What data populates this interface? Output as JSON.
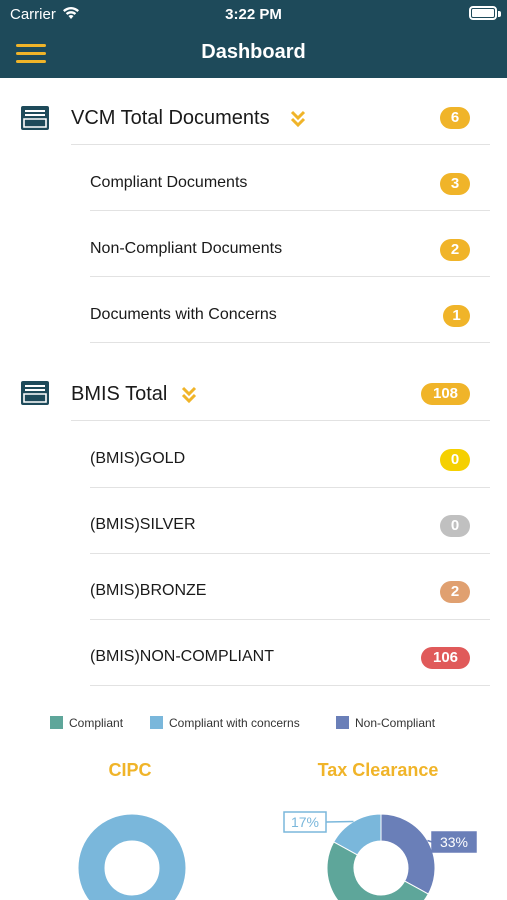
{
  "status_bar": {
    "carrier": "Carrier",
    "time": "3:22 PM"
  },
  "nav": {
    "title": "Dashboard",
    "menu_icon": "hamburger-icon"
  },
  "colors": {
    "header_bg": "#1e4a5a",
    "accent": "#f0b429",
    "badge_orange": "#f0b429",
    "badge_gold": "#f5d000",
    "badge_silver": "#c0c0c0",
    "badge_bronze": "#e0a070",
    "badge_red": "#e05a5a",
    "compliant": "#5ea69a",
    "compliant_with_concerns": "#7ab7db",
    "non_compliant": "#6a7fb8"
  },
  "vcm": {
    "title": "VCM Total Documents",
    "total": "6",
    "icon": "document-tray-icon",
    "items": [
      {
        "label": "Compliant Documents",
        "count": "3"
      },
      {
        "label": "Non-Compliant Documents",
        "count": "2"
      },
      {
        "label": "Documents with Concerns",
        "count": "1"
      }
    ]
  },
  "bmis": {
    "title": "BMIS Total",
    "total": "108",
    "icon": "document-tray-icon",
    "items": [
      {
        "label": "(BMIS)GOLD",
        "count": "0"
      },
      {
        "label": "(BMIS)SILVER",
        "count": "0"
      },
      {
        "label": "(BMIS)BRONZE",
        "count": "2"
      },
      {
        "label": "(BMIS)NON-COMPLIANT",
        "count": "106"
      }
    ]
  },
  "legend": {
    "compliant": "Compliant",
    "compliant_with_concerns": "Compliant with concerns",
    "non_compliant": "Non-Compliant"
  },
  "chart_data": [
    {
      "type": "pie",
      "title": "CIPC",
      "labels": [
        "Compliant with concerns"
      ],
      "values": [
        100
      ],
      "data_labels": []
    },
    {
      "type": "pie",
      "title": "Tax Clearance",
      "labels": [
        "Compliant with concerns",
        "Non-Compliant",
        "Compliant"
      ],
      "values": [
        17,
        33,
        50
      ],
      "data_labels": [
        "17%",
        "33%"
      ]
    }
  ]
}
